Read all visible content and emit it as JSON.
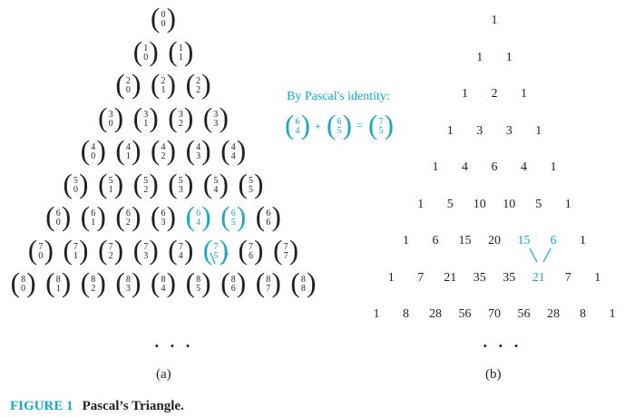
{
  "identity": {
    "caption": "By Pascal's identity:",
    "term1": {
      "n": "6",
      "k": "4"
    },
    "plus": "+",
    "term2": {
      "n": "6",
      "k": "5"
    },
    "equals": "=",
    "result": {
      "n": "7",
      "k": "5"
    }
  },
  "binomial_rows": [
    [
      [
        "0",
        "0"
      ]
    ],
    [
      [
        "1",
        "0"
      ],
      [
        "1",
        "1"
      ]
    ],
    [
      [
        "2",
        "0"
      ],
      [
        "2",
        "1"
      ],
      [
        "2",
        "2"
      ]
    ],
    [
      [
        "3",
        "0"
      ],
      [
        "3",
        "1"
      ],
      [
        "3",
        "2"
      ],
      [
        "3",
        "3"
      ]
    ],
    [
      [
        "4",
        "0"
      ],
      [
        "4",
        "1"
      ],
      [
        "4",
        "2"
      ],
      [
        "4",
        "3"
      ],
      [
        "4",
        "4"
      ]
    ],
    [
      [
        "5",
        "0"
      ],
      [
        "5",
        "1"
      ],
      [
        "5",
        "2"
      ],
      [
        "5",
        "3"
      ],
      [
        "5",
        "4"
      ],
      [
        "5",
        "5"
      ]
    ],
    [
      [
        "6",
        "0"
      ],
      [
        "6",
        "1"
      ],
      [
        "6",
        "2"
      ],
      [
        "6",
        "3"
      ],
      [
        "6",
        "4"
      ],
      [
        "6",
        "5"
      ],
      [
        "6",
        "6"
      ]
    ],
    [
      [
        "7",
        "0"
      ],
      [
        "7",
        "1"
      ],
      [
        "7",
        "2"
      ],
      [
        "7",
        "3"
      ],
      [
        "7",
        "4"
      ],
      [
        "7",
        "5"
      ],
      [
        "7",
        "6"
      ],
      [
        "7",
        "7"
      ]
    ],
    [
      [
        "8",
        "0"
      ],
      [
        "8",
        "1"
      ],
      [
        "8",
        "2"
      ],
      [
        "8",
        "3"
      ],
      [
        "8",
        "4"
      ],
      [
        "8",
        "5"
      ],
      [
        "8",
        "6"
      ],
      [
        "8",
        "7"
      ],
      [
        "8",
        "8"
      ]
    ]
  ],
  "value_rows": [
    [
      "1"
    ],
    [
      "1",
      "1"
    ],
    [
      "1",
      "2",
      "1"
    ],
    [
      "1",
      "3",
      "3",
      "1"
    ],
    [
      "1",
      "4",
      "6",
      "4",
      "1"
    ],
    [
      "1",
      "5",
      "10",
      "10",
      "5",
      "1"
    ],
    [
      "1",
      "6",
      "15",
      "20",
      "15",
      "6",
      "1"
    ],
    [
      "1",
      "7",
      "21",
      "35",
      "35",
      "21",
      "7",
      "1"
    ],
    [
      "1",
      "8",
      "28",
      "56",
      "70",
      "56",
      "28",
      "8",
      "1"
    ]
  ],
  "highlighted_cells": [
    [
      6,
      4
    ],
    [
      6,
      5
    ],
    [
      7,
      5
    ]
  ],
  "highlight_color": "#1aa7c7",
  "text_color": "#231f20",
  "ellipsis": "· · ·",
  "panel_a_label": "(a)",
  "panel_b_label": "(b)",
  "figure": {
    "label": "FIGURE 1",
    "title": "Pascal’s Triangle."
  }
}
